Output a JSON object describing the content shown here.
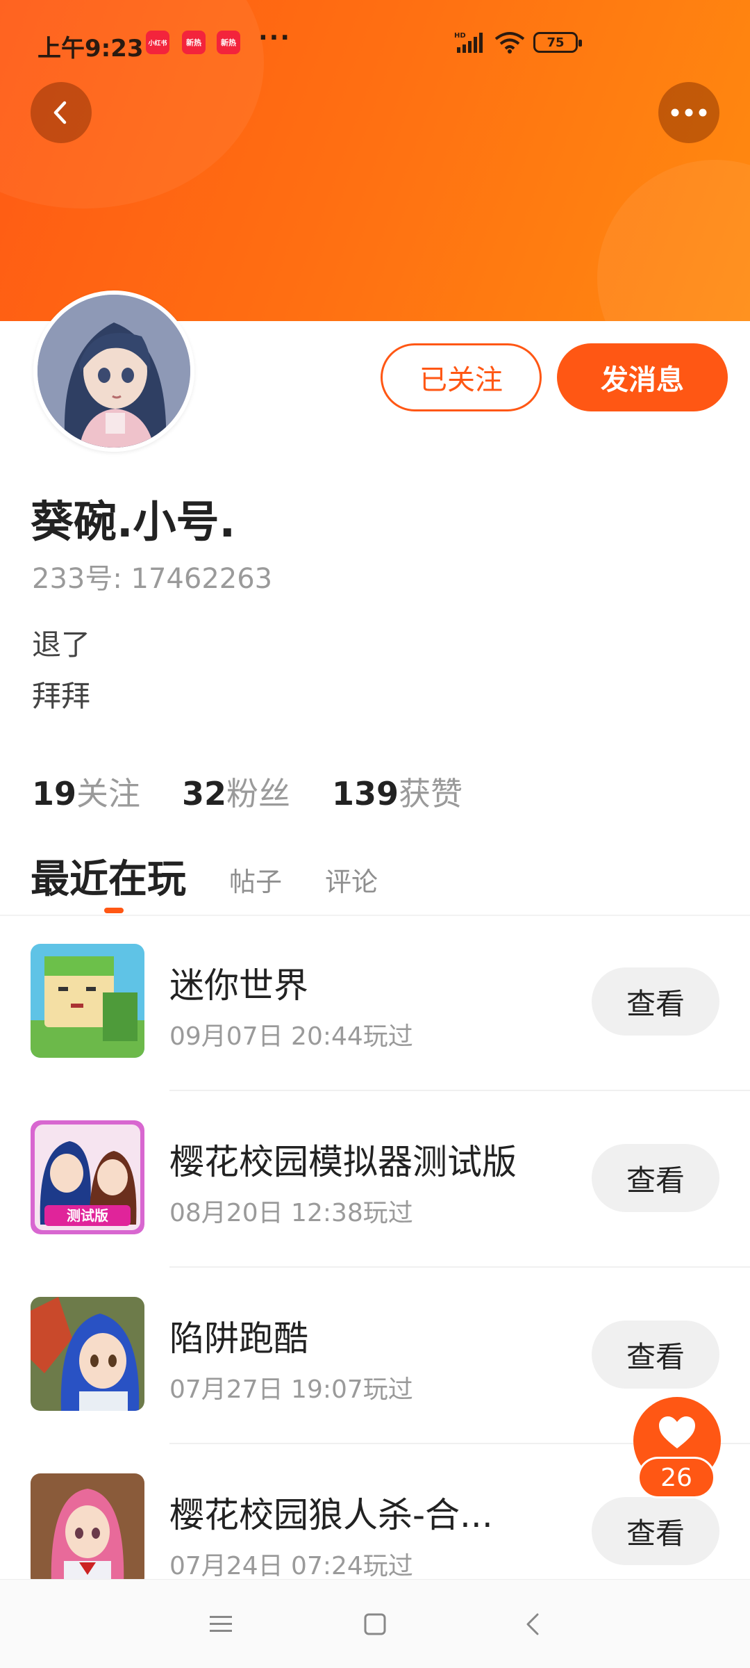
{
  "status_bar": {
    "time": "上午9:23",
    "notifications": [
      "小红书",
      "新热",
      "新热"
    ],
    "more": "···",
    "battery": "75"
  },
  "header": {
    "back_icon": "chevron-left-icon",
    "more_icon": "more-dots-icon"
  },
  "profile": {
    "name": "葵碗.小号.",
    "id_text": "233号: 17462263",
    "bio_lines": [
      "退了",
      "拜拜"
    ],
    "follow_state_label": "已关注",
    "message_label": "发消息",
    "stats": [
      {
        "number": "19",
        "label": "关注"
      },
      {
        "number": "32",
        "label": "粉丝"
      },
      {
        "number": "139",
        "label": "获赞"
      }
    ]
  },
  "tabs": [
    {
      "label": "最近在玩",
      "active": true
    },
    {
      "label": "帖子",
      "active": false
    },
    {
      "label": "评论",
      "active": false
    }
  ],
  "games": [
    {
      "title": "迷你世界",
      "played": "09月07日 20:44玩过",
      "button": "查看"
    },
    {
      "title": "樱花校园模拟器测试版",
      "played": "08月20日 12:38玩过",
      "button": "查看"
    },
    {
      "title": "陷阱跑酷",
      "played": "07月27日 19:07玩过",
      "button": "查看"
    },
    {
      "title": "樱花校园狼人杀-合...",
      "played": "07月24日 07:24玩过",
      "button": "查看"
    }
  ],
  "like_fab": {
    "count": "26",
    "icon": "heart-icon"
  },
  "nav_bar": {
    "icons": [
      "menu-icon",
      "home-square-icon",
      "back-triangle-icon"
    ]
  },
  "colors": {
    "accent": "#ff5714",
    "header_gradient_start": "#ff5a14",
    "header_gradient_end": "#ff8a10"
  }
}
